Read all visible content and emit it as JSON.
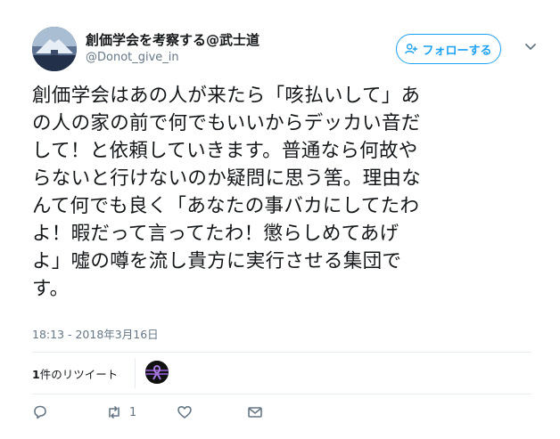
{
  "user": {
    "display_name": "創価学会を考察する@武士道",
    "username": "@Donot_give_in",
    "avatar_icon": "avatar-mountain-image"
  },
  "follow_button": {
    "label": "フォローする",
    "icon": "add-user-icon"
  },
  "tweet": {
    "lines": [
      "創価学会はあの人が来たら「咳払いして」あ",
      "の人の家の前で何でもいいからデッカい音だ",
      "して！と依頼していきます。普通なら何故や",
      "らないと行けないのか疑問に思う筈。理由な",
      "んて何でも良く「あなたの事バカにしてたわ",
      "よ！暇だって言ってたわ！懲らしめてあげ",
      "よ」噓の噂を流し貴方に実行させる集団で",
      "す。"
    ],
    "highlight_color": "#b5f55b",
    "timestamp": "18:13 - 2018年3月16日"
  },
  "stats": {
    "retweet_number": "1",
    "retweet_suffix": "件のリツイート"
  },
  "actions": {
    "reply_icon": "reply-icon",
    "retweet_icon": "retweet-icon",
    "retweet_count": "1",
    "like_icon": "heart-icon",
    "dm_icon": "envelope-icon"
  },
  "colors": {
    "accent": "#1da1f2",
    "secondary_text": "#657786"
  }
}
